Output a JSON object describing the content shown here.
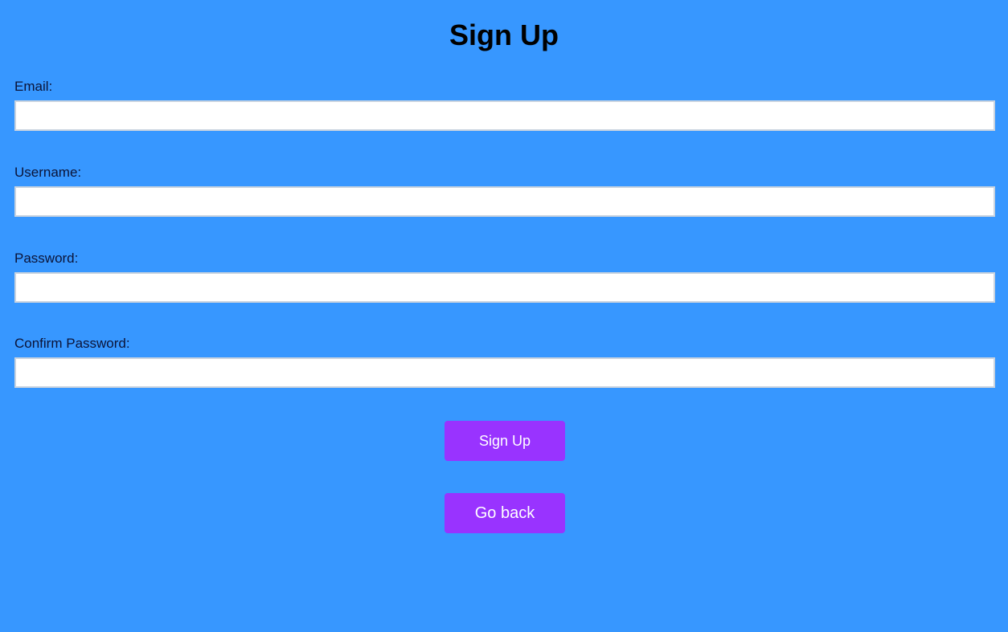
{
  "page": {
    "title": "Sign Up",
    "background_color": "#3797ff",
    "accent_color": "#9933ff"
  },
  "form": {
    "fields": [
      {
        "label": "Email:",
        "value": "",
        "placeholder": ""
      },
      {
        "label": "Username:",
        "value": "",
        "placeholder": ""
      },
      {
        "label": "Password:",
        "value": "",
        "placeholder": ""
      },
      {
        "label": "Confirm Password:",
        "value": "",
        "placeholder": ""
      }
    ],
    "submit_label": "Sign Up",
    "back_label": "Go back"
  }
}
